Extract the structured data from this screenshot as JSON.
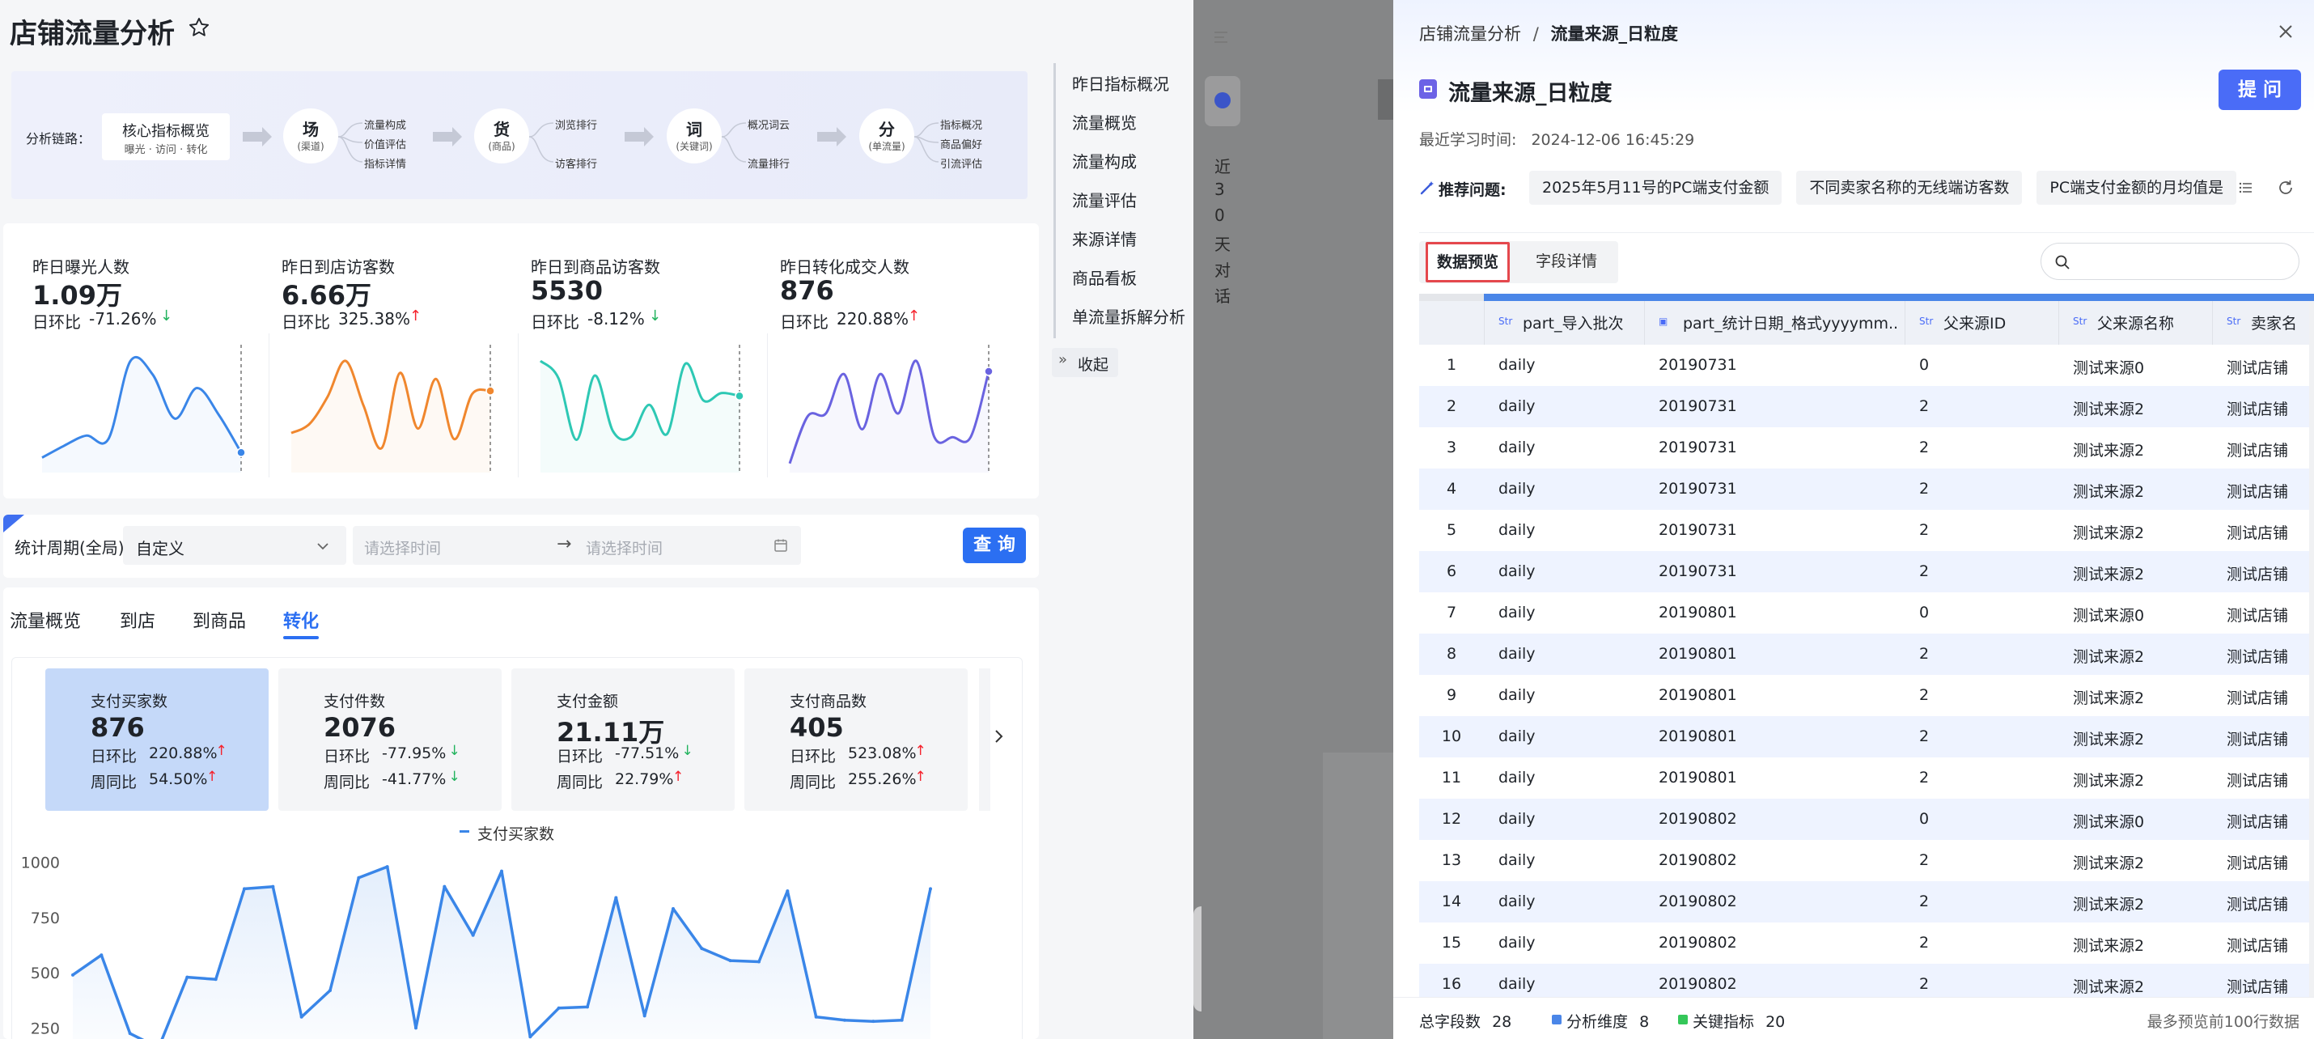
{
  "header": {
    "title": "店铺流量分析"
  },
  "chain": {
    "label": "分析链路：",
    "core": {
      "title": "核心指标概览",
      "sub": "曝光 · 访问 · 转化"
    },
    "nodes": [
      {
        "main": "场",
        "sub": "(渠道)",
        "items": [
          "流量构成",
          "价值评估",
          "指标详情"
        ]
      },
      {
        "main": "货",
        "sub": "(商品)",
        "items": [
          "浏览排行",
          "访客排行"
        ]
      },
      {
        "main": "词",
        "sub": "(关键词)",
        "items": [
          "概况词云",
          "流量排行"
        ]
      },
      {
        "main": "分",
        "sub": "(单流量)",
        "items": [
          "指标概况",
          "商品偏好",
          "引流评估"
        ]
      }
    ]
  },
  "kpis": [
    {
      "title": "昨日曝光人数",
      "value": "1.09万",
      "cmp_label": "日环比",
      "cmp": "-71.26%",
      "dir": "down",
      "color": "#3a86e8",
      "series": [
        5,
        12,
        18,
        16,
        62,
        54,
        28,
        46,
        30,
        8
      ]
    },
    {
      "title": "昨日到店访客数",
      "value": "6.66万",
      "cmp_label": "日环比",
      "cmp": "325.38%",
      "dir": "up",
      "color": "#f0872e",
      "series": [
        22,
        28,
        46,
        70,
        40,
        12,
        62,
        25,
        58,
        18,
        48,
        50
      ]
    },
    {
      "title": "昨日到商品访客数",
      "value": "5530",
      "cmp_label": "日环比",
      "cmp": "-8.12%",
      "dir": "down",
      "color": "#2ec8b4",
      "series": [
        72,
        60,
        18,
        62,
        24,
        20,
        42,
        22,
        70,
        45,
        50,
        48
      ]
    },
    {
      "title": "昨日转化成交人数",
      "value": "876",
      "cmp_label": "日环比",
      "cmp": "220.88%",
      "dir": "up",
      "color": "#6a63e0",
      "series": [
        2,
        38,
        40,
        70,
        28,
        70,
        40,
        80,
        22,
        22,
        22,
        72
      ]
    }
  ],
  "sidenav": {
    "items": [
      "昨日指标概况",
      "流量概览",
      "流量构成",
      "流量评估",
      "来源详情",
      "商品看板",
      "单流量拆解分析"
    ],
    "collapse": "收起"
  },
  "filter": {
    "label": "统计周期(全局)",
    "period": "自定义",
    "start_ph": "请选择时间",
    "end_ph": "请选择时间",
    "query": "查 询"
  },
  "tabs": [
    "流量概览",
    "到店",
    "到商品",
    "转化"
  ],
  "metrics": [
    {
      "name": "支付买家数",
      "value": "876",
      "day_label": "日环比",
      "day": "220.88%",
      "day_dir": "up",
      "week_label": "周同比",
      "week": "54.50%",
      "week_dir": "up",
      "active": true
    },
    {
      "name": "支付件数",
      "value": "2076",
      "day_label": "日环比",
      "day": "-77.95%",
      "day_dir": "down",
      "week_label": "周同比",
      "week": "-41.77%",
      "week_dir": "down",
      "active": false
    },
    {
      "name": "支付金额",
      "value": "21.11万",
      "day_label": "日环比",
      "day": "-77.51%",
      "day_dir": "down",
      "week_label": "周同比",
      "week": "22.79%",
      "week_dir": "up",
      "active": false
    },
    {
      "name": "支付商品数",
      "value": "405",
      "day_label": "日环比",
      "day": "523.08%",
      "day_dir": "up",
      "week_label": "周同比",
      "week": "255.26%",
      "week_dir": "up",
      "active": false
    }
  ],
  "chart_data": {
    "type": "line",
    "legend": "支付买家数",
    "ylim": [
      200,
      1050
    ],
    "yticks": [
      "1000",
      "750",
      "500",
      "250"
    ],
    "values": [
      490,
      580,
      225,
      160,
      480,
      470,
      880,
      890,
      300,
      420,
      930,
      980,
      250,
      890,
      670,
      960,
      210,
      340,
      345,
      840,
      305,
      790,
      610,
      555,
      550,
      870,
      300,
      285,
      280,
      285,
      880
    ]
  },
  "overlay": {
    "vertical": [
      "近",
      "3",
      "0",
      "天",
      "对",
      "话"
    ]
  },
  "drawer": {
    "breadcrumb_parent": "店铺流量分析",
    "breadcrumb_sep": "/",
    "breadcrumb_current": "流量来源_日粒度",
    "title": "流量来源_日粒度",
    "ask_button": "提 问",
    "learn_label": "最近学习时间:",
    "learn_time": "2024-12-06 16:45:29",
    "rec_label": "推荐问题:",
    "rec_questions": [
      "2025年5月11号的PC端支付金额",
      "不同卖家名称的无线端访客数",
      "PC端支付金额的月均值是"
    ],
    "tabs": [
      "数据预览",
      "字段详情"
    ],
    "search_placeholder": "",
    "columns": [
      {
        "type": "Str",
        "name": "part_导入批次"
      },
      {
        "type": "date",
        "name": "part_统计日期_格式yyyymm..."
      },
      {
        "type": "Str",
        "name": "父来源ID"
      },
      {
        "type": "Str",
        "name": "父来源名称"
      },
      {
        "type": "Str",
        "name": "卖家名"
      }
    ],
    "rows": [
      [
        "1",
        "daily",
        "20190731",
        "0",
        "测试来源0",
        "测试店铺"
      ],
      [
        "2",
        "daily",
        "20190731",
        "2",
        "测试来源2",
        "测试店铺"
      ],
      [
        "3",
        "daily",
        "20190731",
        "2",
        "测试来源2",
        "测试店铺"
      ],
      [
        "4",
        "daily",
        "20190731",
        "2",
        "测试来源2",
        "测试店铺"
      ],
      [
        "5",
        "daily",
        "20190731",
        "2",
        "测试来源2",
        "测试店铺"
      ],
      [
        "6",
        "daily",
        "20190731",
        "2",
        "测试来源2",
        "测试店铺"
      ],
      [
        "7",
        "daily",
        "20190801",
        "0",
        "测试来源0",
        "测试店铺"
      ],
      [
        "8",
        "daily",
        "20190801",
        "2",
        "测试来源2",
        "测试店铺"
      ],
      [
        "9",
        "daily",
        "20190801",
        "2",
        "测试来源2",
        "测试店铺"
      ],
      [
        "10",
        "daily",
        "20190801",
        "2",
        "测试来源2",
        "测试店铺"
      ],
      [
        "11",
        "daily",
        "20190801",
        "2",
        "测试来源2",
        "测试店铺"
      ],
      [
        "12",
        "daily",
        "20190802",
        "0",
        "测试来源0",
        "测试店铺"
      ],
      [
        "13",
        "daily",
        "20190802",
        "2",
        "测试来源2",
        "测试店铺"
      ],
      [
        "14",
        "daily",
        "20190802",
        "2",
        "测试来源2",
        "测试店铺"
      ],
      [
        "15",
        "daily",
        "20190802",
        "2",
        "测试来源2",
        "测试店铺"
      ],
      [
        "16",
        "daily",
        "20190802",
        "2",
        "测试来源2",
        "测试店铺"
      ]
    ],
    "footer": {
      "total_label": "总字段数",
      "total": "28",
      "dim_label": "分析维度",
      "dim": "8",
      "kpi_label": "关键指标",
      "kpi": "20",
      "note": "最多预览前100行数据"
    },
    "colors": {
      "accent": "#4a6cf7",
      "dim": "#4a86e8",
      "kpi": "#34c759"
    }
  }
}
